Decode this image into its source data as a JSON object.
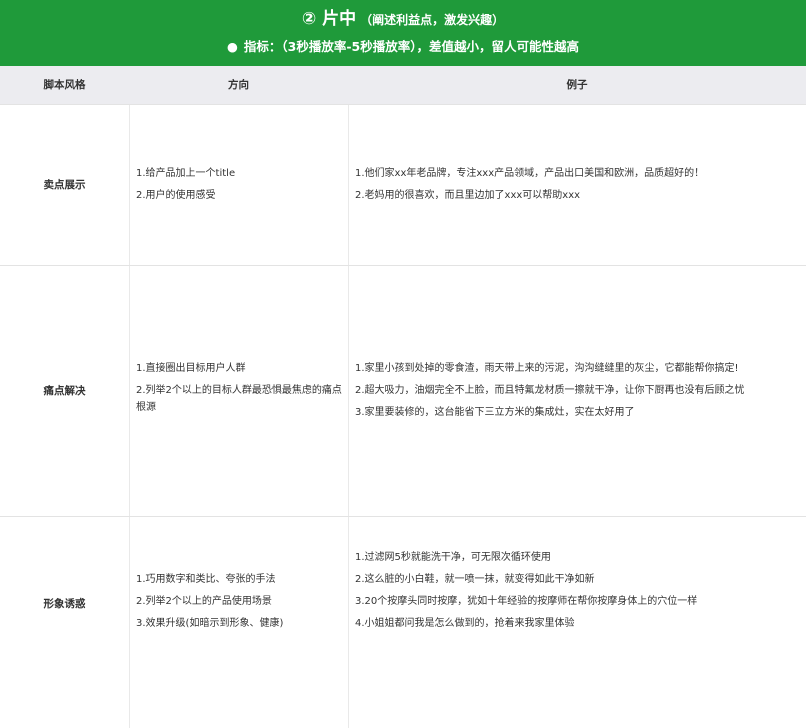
{
  "banner": {
    "circle_num": "②",
    "title": "片中",
    "subtitle": "（阐述利益点，激发兴趣）",
    "bullet": "●",
    "metric_label": "指标：",
    "metric_text": "（3秒播放率-5秒播放率），差值越小，留人可能性越高"
  },
  "table": {
    "headers": [
      "脚本风格",
      "方向",
      "例子"
    ],
    "rows": [
      {
        "style": "卖点展示",
        "direction": [
          "1.给产品加上一个title",
          "2.用户的使用感受"
        ],
        "examples": [
          "1.他们家xx年老品牌，专注xxx产品领域，产品出口美国和欧洲，品质超好的！",
          "2.老妈用的很喜欢，而且里边加了xxx可以帮助xxx"
        ]
      },
      {
        "style": "痛点解决",
        "direction": [
          "1.直接圈出目标用户人群",
          "2.列举2个以上的目标人群最恐惧最焦虑的痛点根源"
        ],
        "examples": [
          "1.家里小孩到处掉的零食渣，雨天带上来的污泥，沟沟缝缝里的灰尘，它都能帮你搞定!",
          "2.超大吸力，油烟完全不上脸，而且特氟龙材质一擦就干净，让你下厨再也没有后顾之忧",
          "3.家里要装修的，这台能省下三立方米的集成灶，实在太好用了"
        ]
      },
      {
        "style": "形象诱惑",
        "direction": [
          "1.巧用数字和类比、夸张的手法",
          "2.列举2个以上的产品使用场景",
          "3.效果升级(如暗示到形象、健康)"
        ],
        "examples": [
          "1.过滤网5秒就能洗干净，可无限次循环使用",
          "2.这么脏的小白鞋，就一喷一抹，就变得如此干净如新",
          "3.20个按摩头同时按摩，犹如十年经验的按摩师在帮你按摩身体上的穴位一样",
          "4.小姐姐都问我是怎么做到的，抢着来我家里体验"
        ]
      }
    ]
  }
}
